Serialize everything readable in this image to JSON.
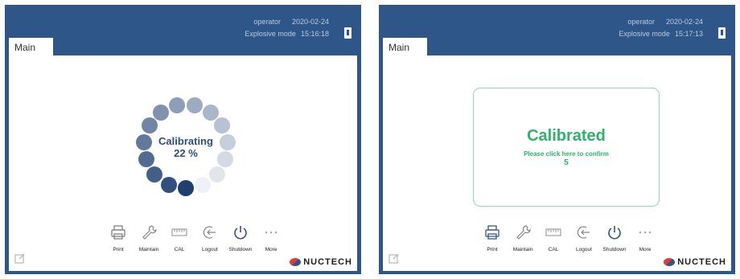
{
  "left_screen": {
    "status": {
      "user": "operator",
      "date": "2020-02-24",
      "mode": "Explosive mode",
      "time": "15:16:18"
    },
    "tab_label": "Main",
    "calibration": {
      "label": "Calibrating",
      "progress_text": "22 %",
      "progress_percent": 22
    },
    "toolbar": [
      {
        "icon": "printer-icon",
        "label": "Print"
      },
      {
        "icon": "wrench-icon",
        "label": "Maintain"
      },
      {
        "icon": "ruler-icon",
        "label": "CAL"
      },
      {
        "icon": "logout-icon",
        "label": "Logout"
      },
      {
        "icon": "power-icon",
        "label": "Shutdown"
      },
      {
        "icon": "more-icon",
        "label": "More"
      }
    ],
    "brand": "NUCTECH"
  },
  "right_screen": {
    "status": {
      "user": "operator",
      "date": "2020-02-24",
      "mode": "Explosive mode",
      "time": "15:17:13"
    },
    "tab_label": "Main",
    "dialog": {
      "title": "Calibrated",
      "message": "Please click here to confirm",
      "countdown": "5"
    },
    "toolbar": [
      {
        "icon": "printer-icon",
        "label": "Print"
      },
      {
        "icon": "wrench-icon",
        "label": "Maintain"
      },
      {
        "icon": "ruler-icon",
        "label": "CAL"
      },
      {
        "icon": "logout-icon",
        "label": "Logout"
      },
      {
        "icon": "power-icon",
        "label": "Shutdown"
      },
      {
        "icon": "more-icon",
        "label": "More"
      }
    ],
    "brand": "NUCTECH"
  },
  "colors": {
    "frame": "#2f5688",
    "status_text": "#b9cae3",
    "success": "#2fb36a",
    "accent_text": "#2f4f78"
  }
}
